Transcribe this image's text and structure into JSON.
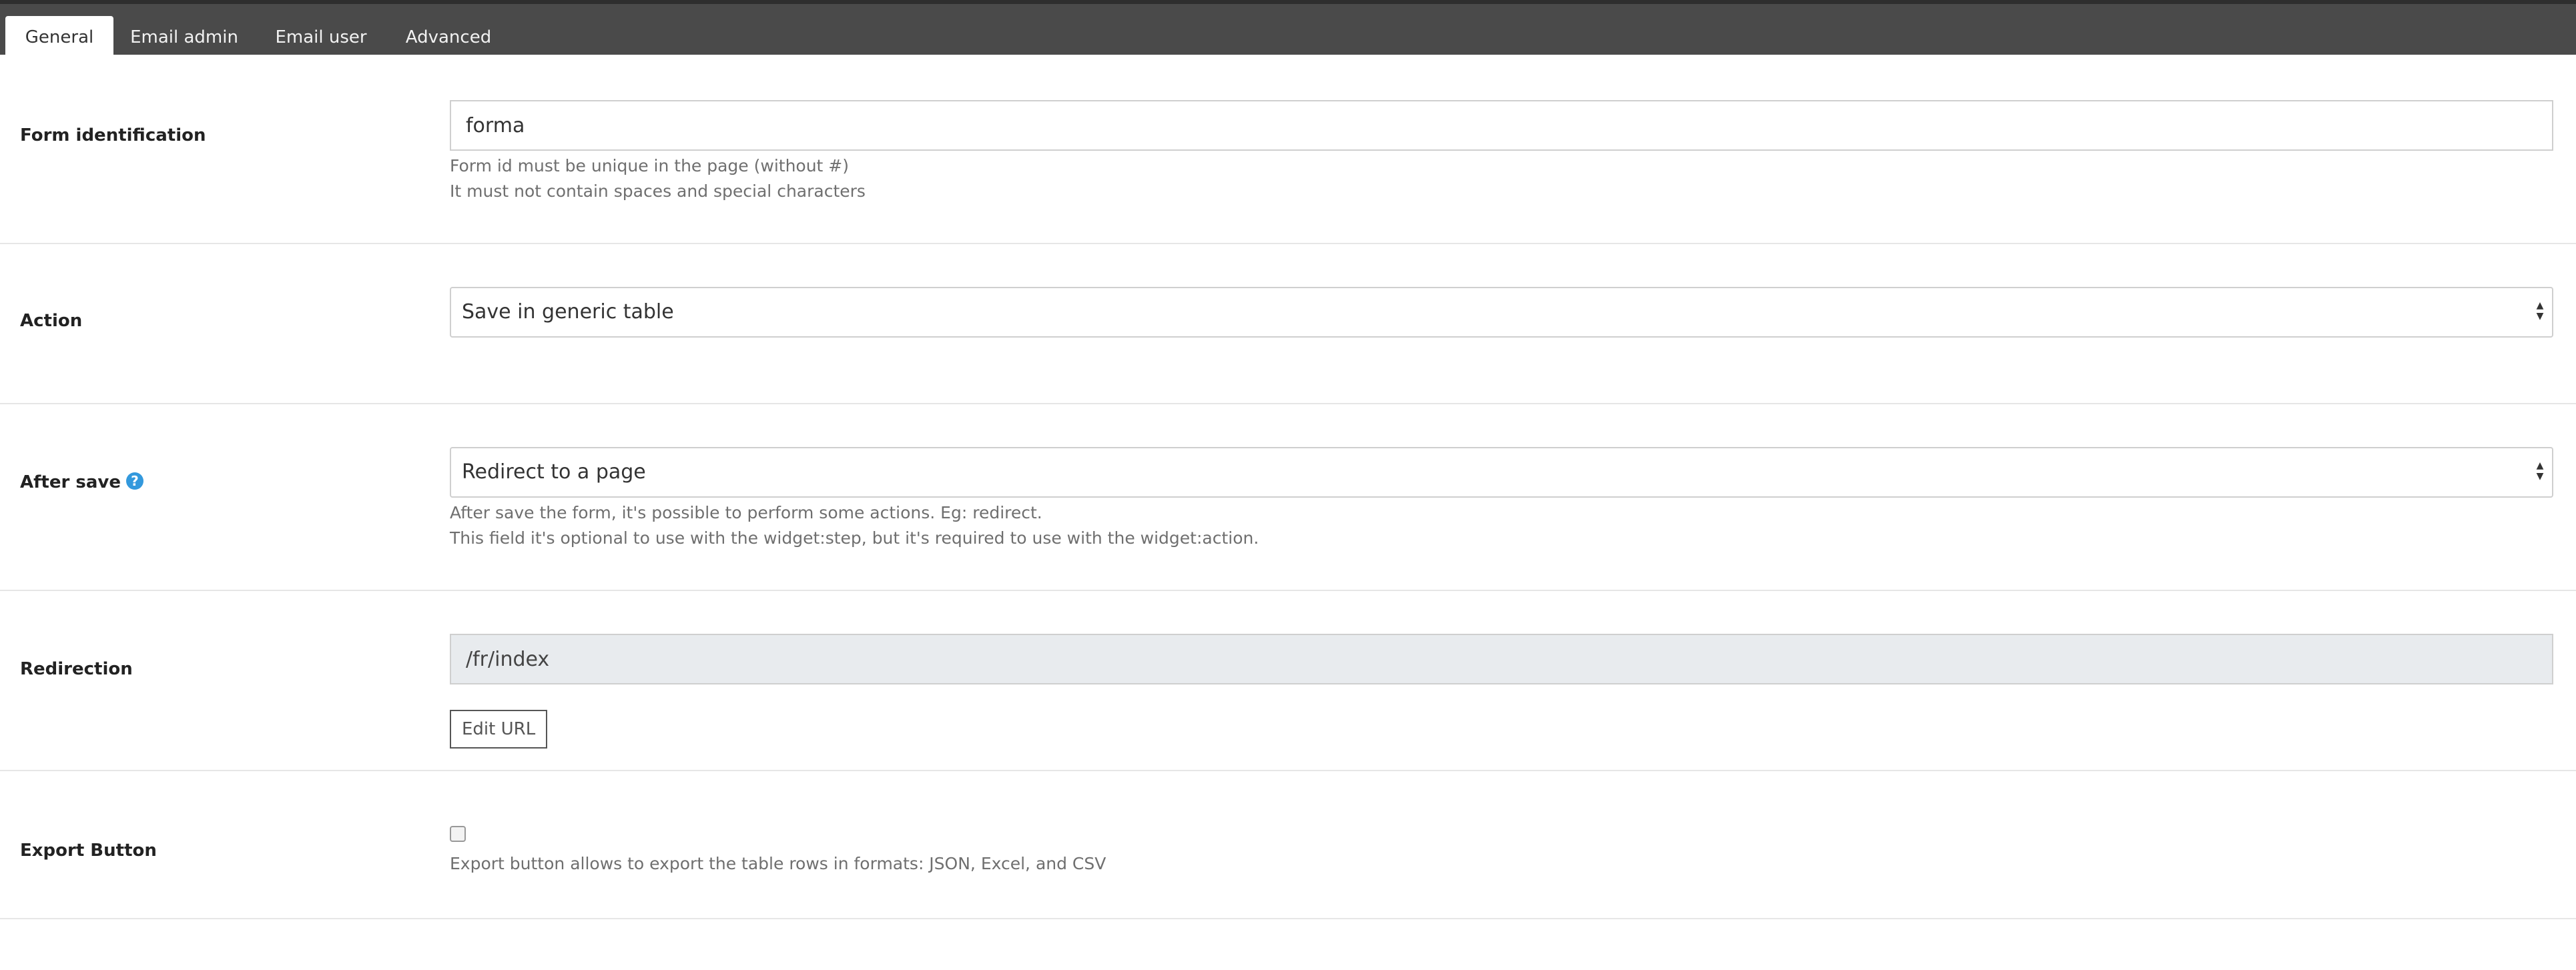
{
  "tabs": [
    {
      "label": "General",
      "active": true
    },
    {
      "label": "Email admin",
      "active": false
    },
    {
      "label": "Email user",
      "active": false
    },
    {
      "label": "Advanced",
      "active": false
    }
  ],
  "form_identification": {
    "label": "Form identification",
    "value": "forma",
    "help_lines": [
      "Form id must be unique in the page (without #)",
      "It must not contain spaces and special characters"
    ]
  },
  "action": {
    "label": "Action",
    "selected": "Save in generic table"
  },
  "after_save": {
    "label": "After save",
    "help_icon_glyph": "?",
    "selected": "Redirect to a page",
    "help_lines": [
      "After save the form, it's possible to perform some actions. Eg: redirect.",
      "This field it's optional to use with the widget:step, but it's required to use with the widget:action."
    ]
  },
  "redirection": {
    "label": "Redirection",
    "value": "/fr/index",
    "edit_button_label": "Edit URL"
  },
  "export_button": {
    "label": "Export Button",
    "checked": false,
    "help": "Export button allows to export the table rows in formats: JSON, Excel, and CSV"
  },
  "colors": {
    "tabbar_bg": "#4a4a4a",
    "help_icon": "#3399dd",
    "readonly_bg": "#e8ebee"
  }
}
